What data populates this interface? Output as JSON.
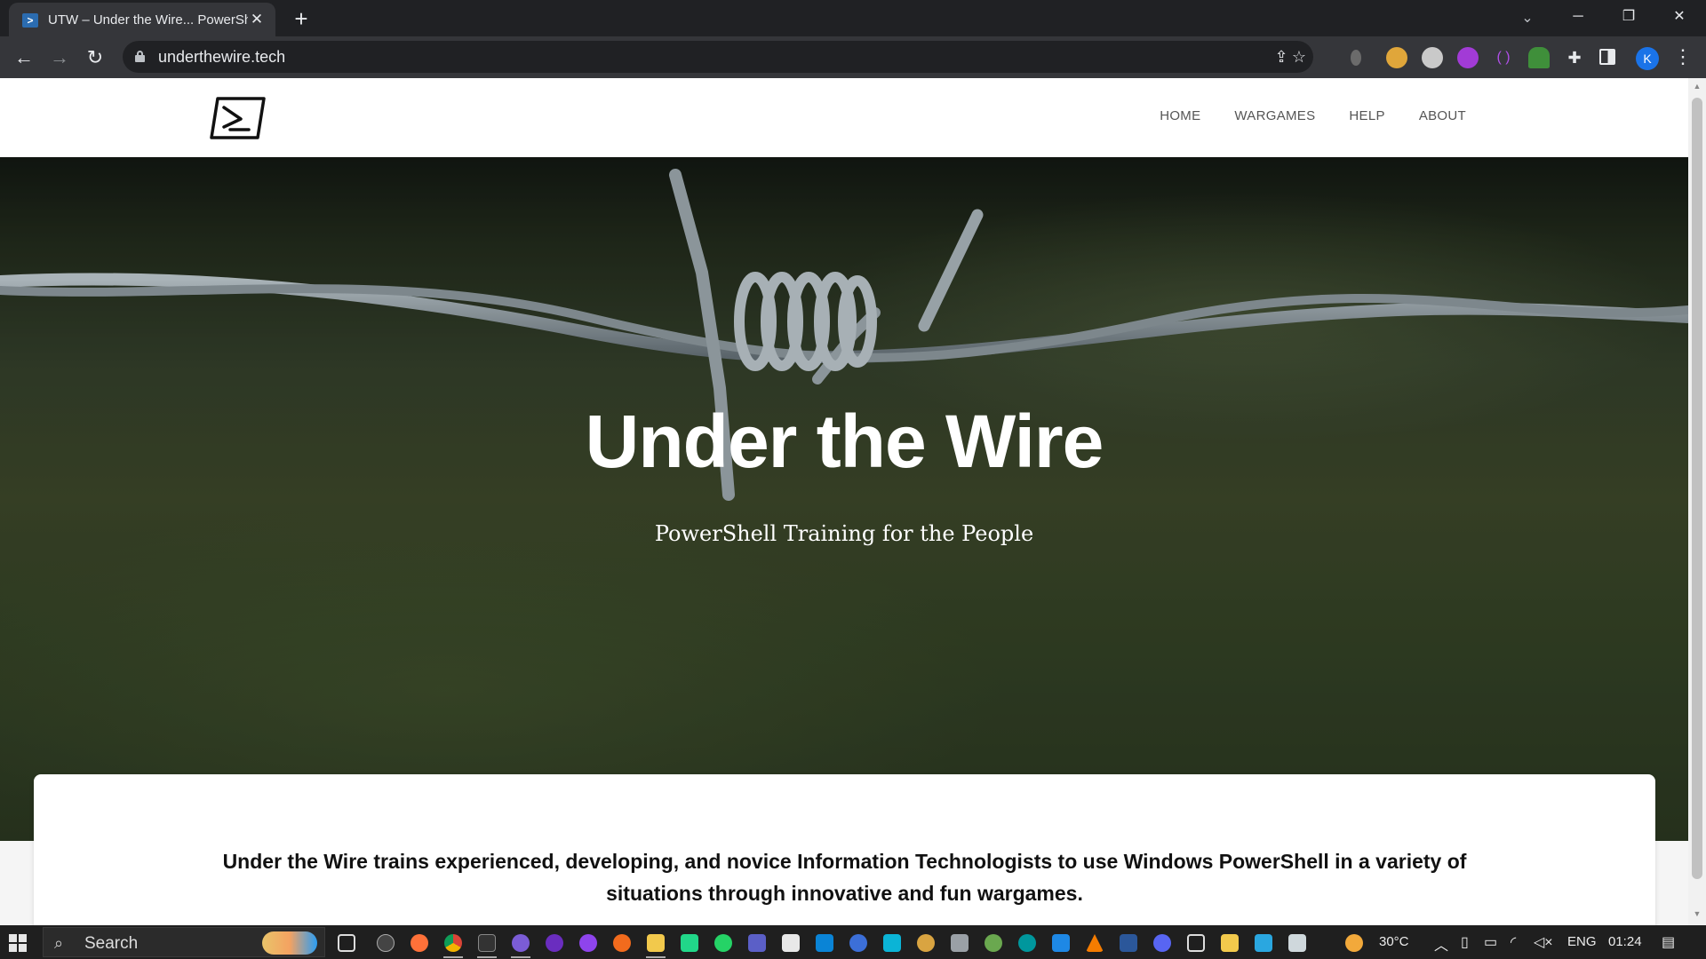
{
  "browser": {
    "tab_title": "UTW – Under the Wire... PowerShell",
    "tab_favicon_icon": "powershell-icon",
    "url": "underthewire.tech",
    "profile_initial": "K"
  },
  "site": {
    "nav": [
      "HOME",
      "WARGAMES",
      "HELP",
      "ABOUT"
    ],
    "hero_title": "Under the Wire",
    "hero_subtitle": "PowerShell Training for the People",
    "intro_text": "Under the Wire trains experienced, developing, and novice Information Technologists to use Windows PowerShell in a variety of situations through innovative and fun wargames."
  },
  "taskbar": {
    "search_label": "Search",
    "temperature": "30°C",
    "language": "ENG",
    "time": "01:24"
  },
  "colors": {
    "chrome_dark": "#202124",
    "chrome_toolbar": "#35363a",
    "taskbar": "#1f1f1f",
    "profile": "#1a73e8"
  }
}
